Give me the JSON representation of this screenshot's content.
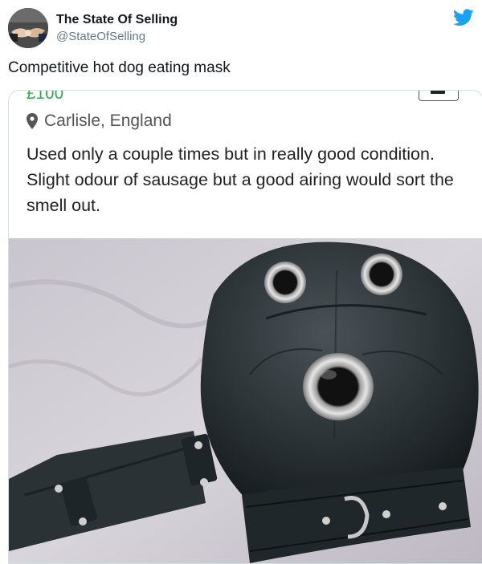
{
  "tweet": {
    "display_name": "The State Of Selling",
    "handle": "@StateOfSelling",
    "text": "Competitive hot dog eating mask"
  },
  "listing": {
    "price": "£100",
    "location": "Carlisle, England",
    "description": "Used only a couple times but in really good condition. Slight odour of sausage but a good airing would sort the smell out."
  },
  "icons": {
    "brand": "twitter-bird-icon",
    "location": "map-pin-icon",
    "message": "message-icon"
  },
  "colors": {
    "brand_blue": "#1da1f2",
    "price_green": "#2ea44f",
    "handle_gray": "#657786"
  }
}
